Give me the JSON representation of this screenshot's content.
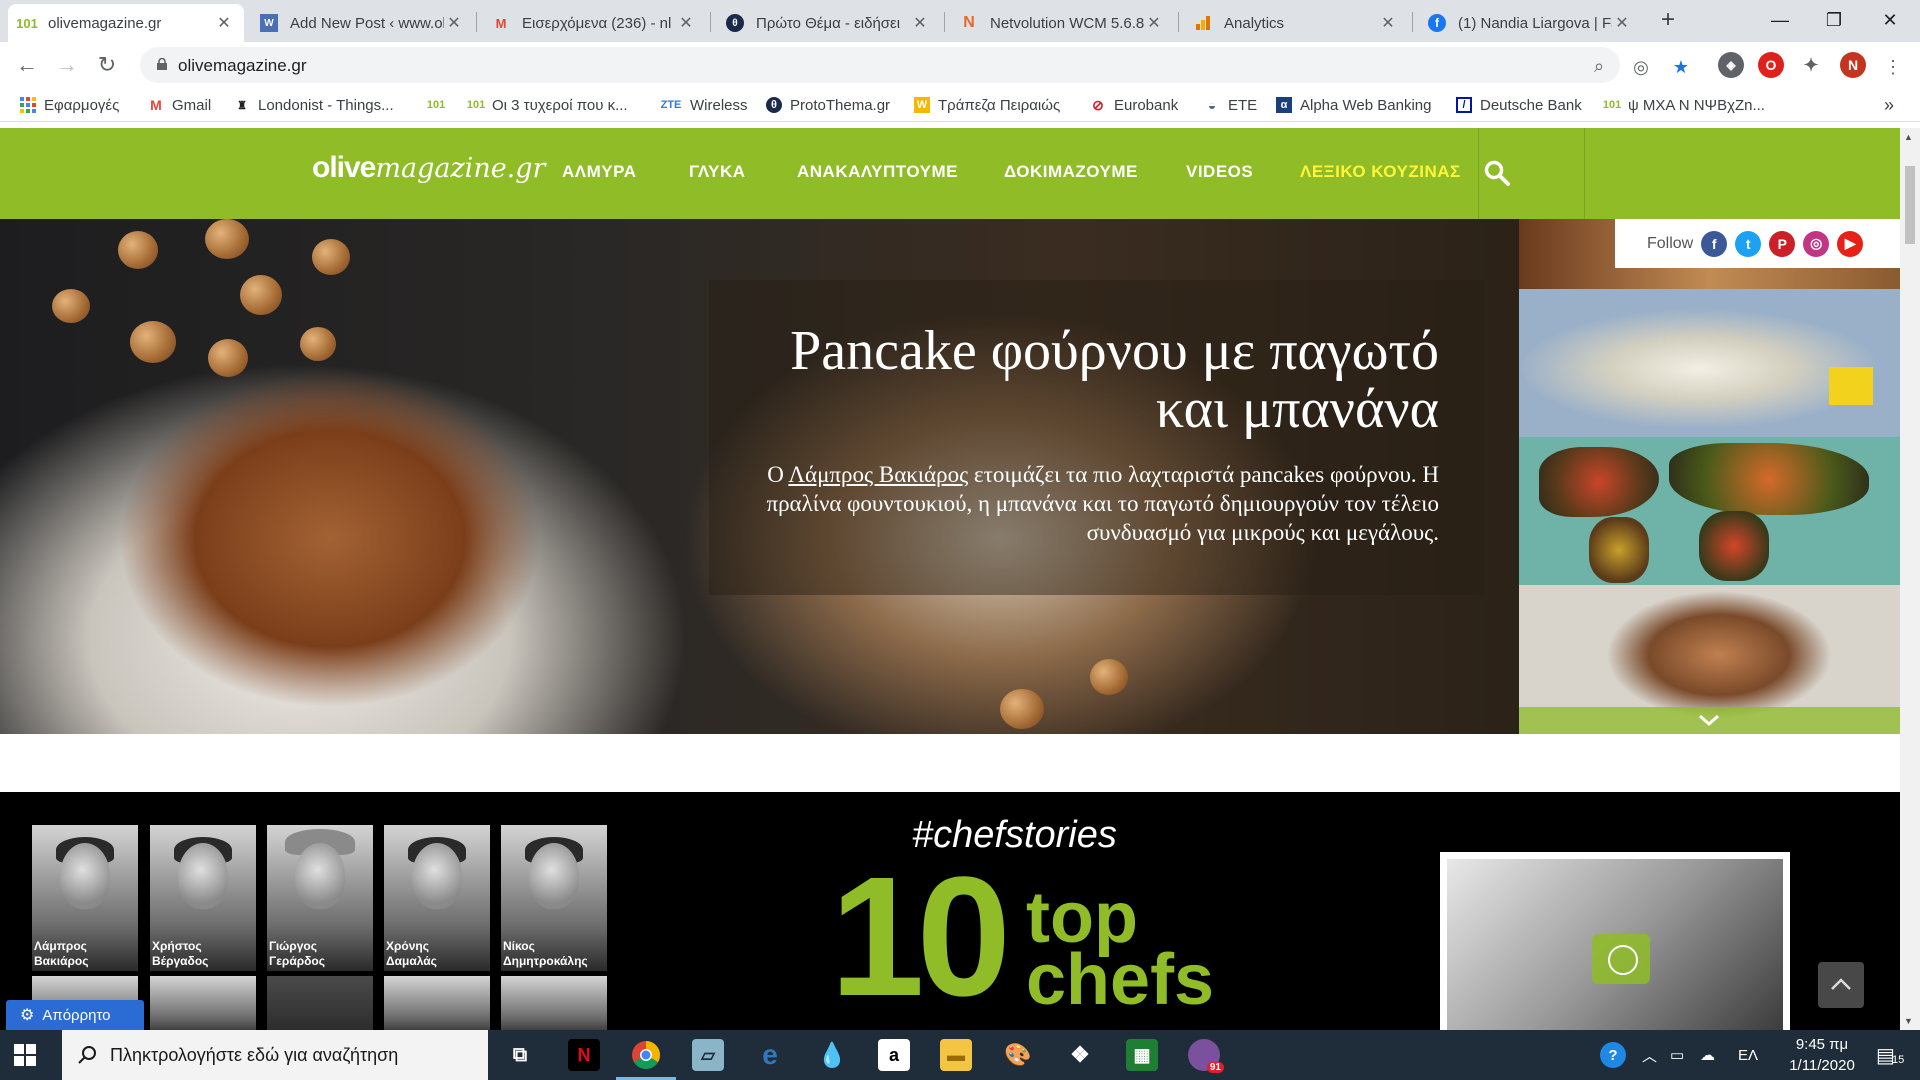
{
  "tabs": [
    {
      "title": "olivemagazine.gr",
      "icon": "olive-icon",
      "active": true
    },
    {
      "title": "Add New Post ‹ www.ol",
      "icon": "wordpress-icon"
    },
    {
      "title": "Εισερχόμενα (236) - nl",
      "icon": "gmail-icon"
    },
    {
      "title": "Πρώτο Θέμα - ειδήσει",
      "icon": "protothema-icon"
    },
    {
      "title": "Netvolution WCM 5.6.8",
      "icon": "netvolution-icon"
    },
    {
      "title": "Analytics",
      "icon": "analytics-icon"
    },
    {
      "title": "(1) Nandia Liargova | Fa",
      "icon": "facebook-icon"
    }
  ],
  "address": {
    "url": "olivemagazine.gr"
  },
  "profile_initial": "N",
  "bookmarks": [
    {
      "label": "Εφαρμογές",
      "icon": "apps-grid-icon"
    },
    {
      "label": "Gmail",
      "icon": "gmail-icon"
    },
    {
      "label": "Londonist - Things...",
      "icon": "londonist-icon"
    },
    {
      "label": "",
      "icon": "olive-icon"
    },
    {
      "label": "Οι 3 τυχεροί που κ...",
      "icon": "olive-icon"
    },
    {
      "label": "Wireless",
      "icon": "zte-icon"
    },
    {
      "label": "ProtoThema.gr",
      "icon": "protothema-icon"
    },
    {
      "label": "Τράπεζα Πειραιώς",
      "icon": "piraeus-icon"
    },
    {
      "label": "Eurobank",
      "icon": "eurobank-icon"
    },
    {
      "label": "ETE",
      "icon": "ete-icon"
    },
    {
      "label": "Alpha Web Banking",
      "icon": "alpha-icon"
    },
    {
      "label": "Deutsche Bank",
      "icon": "deutsche-bank-icon"
    },
    {
      "label": "ψ ΜΧΑ Ν  ΝΨΒχΖn...",
      "icon": "olive-icon"
    }
  ],
  "site": {
    "logo_bold": "olive",
    "logo_italic": "magazine.gr",
    "menu": [
      "ΑΛΜΥΡΑ",
      "ΓΛΥΚΑ",
      "ΑΝΑΚΑΛΥΠΤΟΥΜΕ",
      "ΔΟΚΙΜΑΖΟΥΜΕ",
      "VIDEOS",
      "ΛΕΞΙΚΟ ΚΟΥΖΙΝΑΣ"
    ],
    "highlight_color": "#fff53a",
    "brand_color": "#8fbc27"
  },
  "hero": {
    "title": "Pancake φούρνου με παγωτό και μπανάνα",
    "desc_prefix": "Ο ",
    "desc_link": "Λάμπρος Βακιάρος",
    "desc_rest": " ετοιμάζει τα πιο λαχταριστά pancakes φούρνου.  Η πραλίνα φουντουκιού, η μπανάνα και το παγωτό δημιουργούν τον τέλειο συνδυασμό για μικρούς και μεγάλους."
  },
  "follow": {
    "label": "Follow",
    "networks": [
      "facebook-icon",
      "twitter-icon",
      "pinterest-icon",
      "instagram-icon",
      "youtube-icon"
    ]
  },
  "chefstories": {
    "hashtag": "#chefstories",
    "number": "10",
    "line1": "top",
    "line2": "chefs",
    "chefs": [
      {
        "first": "Λάμπρος",
        "last": "Βακιάρος"
      },
      {
        "first": "Χρήστος",
        "last": "Βέργαδος"
      },
      {
        "first": "Γιώργος",
        "last": "Γεράρδος"
      },
      {
        "first": "Χρόνης",
        "last": "Δαμαλάς"
      },
      {
        "first": "Νίκος",
        "last": "Δημητροκάλης"
      }
    ]
  },
  "privacy": {
    "label": "Απόρρητο"
  },
  "taskbar": {
    "search_placeholder": "Πληκτρολογήστε εδώ για αναζήτηση",
    "language": "ΕΛ",
    "time": "9:45 πμ",
    "date": "1/11/2020",
    "viber_badge": "91",
    "notification_count": "15"
  }
}
